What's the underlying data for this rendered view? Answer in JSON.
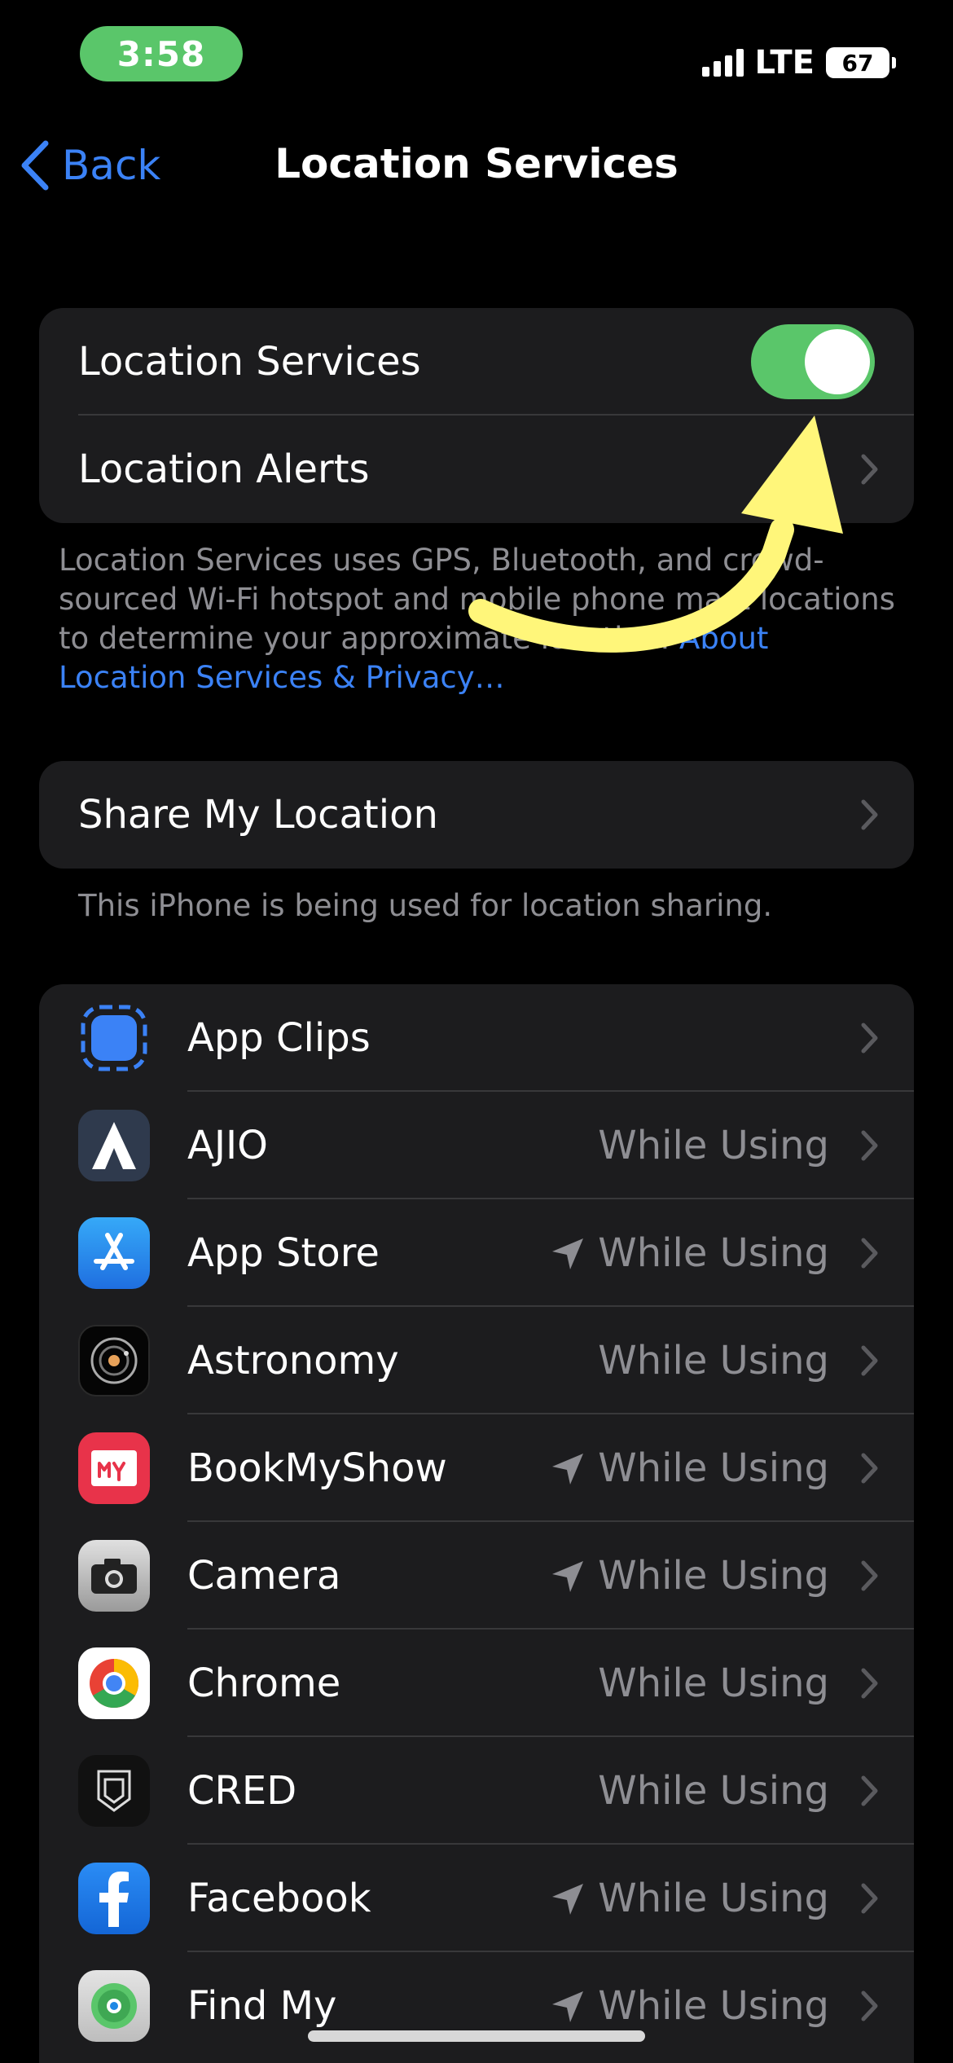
{
  "status_bar": {
    "time": "3:58",
    "network": "LTE",
    "battery": "67"
  },
  "nav": {
    "back_label": "Back",
    "title": "Location Services"
  },
  "settings": {
    "location_services_label": "Location Services",
    "location_services_on": true,
    "location_alerts_label": "Location Alerts",
    "description": "Location Services uses GPS, Bluetooth, and crowd-sourced Wi-Fi hotspot and mobile phone mast locations to determine your approximate location.",
    "description_link": "About Location Services & Privacy…"
  },
  "share": {
    "label": "Share My Location",
    "footnote": "This iPhone is being used for location sharing."
  },
  "apps": [
    {
      "name": "App Clips",
      "status": "",
      "recent_use": false,
      "icon": "app-clips-icon"
    },
    {
      "name": "AJIO",
      "status": "While Using",
      "recent_use": false,
      "icon": "ajio-icon"
    },
    {
      "name": "App Store",
      "status": "While Using",
      "recent_use": true,
      "icon": "app-store-icon"
    },
    {
      "name": "Astronomy",
      "status": "While Using",
      "recent_use": false,
      "icon": "astronomy-icon"
    },
    {
      "name": "BookMyShow",
      "status": "While Using",
      "recent_use": true,
      "icon": "bookmyshow-icon"
    },
    {
      "name": "Camera",
      "status": "While Using",
      "recent_use": true,
      "icon": "camera-icon"
    },
    {
      "name": "Chrome",
      "status": "While Using",
      "recent_use": false,
      "icon": "chrome-icon"
    },
    {
      "name": "CRED",
      "status": "While Using",
      "recent_use": false,
      "icon": "cred-icon"
    },
    {
      "name": "Facebook",
      "status": "While Using",
      "recent_use": true,
      "icon": "facebook-icon"
    },
    {
      "name": "Find My",
      "status": "While Using",
      "recent_use": true,
      "icon": "find-my-icon"
    }
  ],
  "colors": {
    "accent": "#3b82f6",
    "toggle_on": "#5ac66a",
    "annotation": "#fff67a"
  }
}
